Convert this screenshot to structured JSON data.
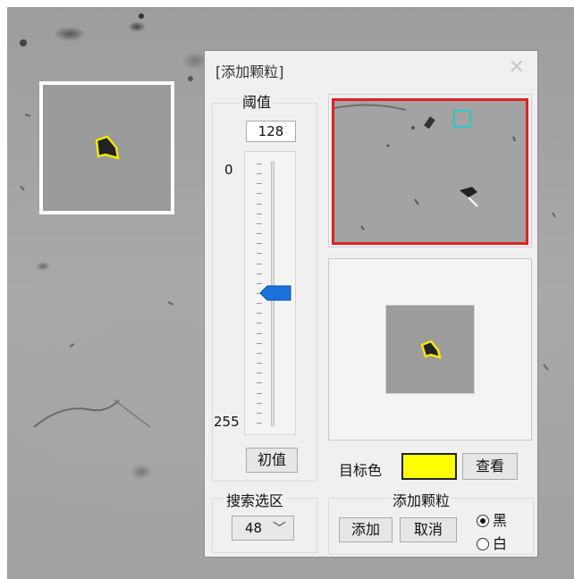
{
  "dialog": {
    "title": "[添加颗粒]",
    "close_icon": "close-icon"
  },
  "threshold": {
    "label": "阈值",
    "value": "128",
    "min_label": "0",
    "max_label": "255",
    "level_fraction": 0.5,
    "init_button": "初值"
  },
  "search_region": {
    "label": "搜索选区",
    "selected": "48"
  },
  "target_color": {
    "label": "目标色",
    "color": "#ffff00",
    "view_button": "查看"
  },
  "add_particle": {
    "label": "添加颗粒",
    "add_button": "添加",
    "cancel_button": "取消",
    "options": [
      {
        "label": "黑",
        "selected": true
      },
      {
        "label": "白",
        "selected": false
      }
    ]
  },
  "colors": {
    "preview_border": "#e02020",
    "cursor_box": "#33c5c5",
    "highlight": "#ffff00"
  }
}
